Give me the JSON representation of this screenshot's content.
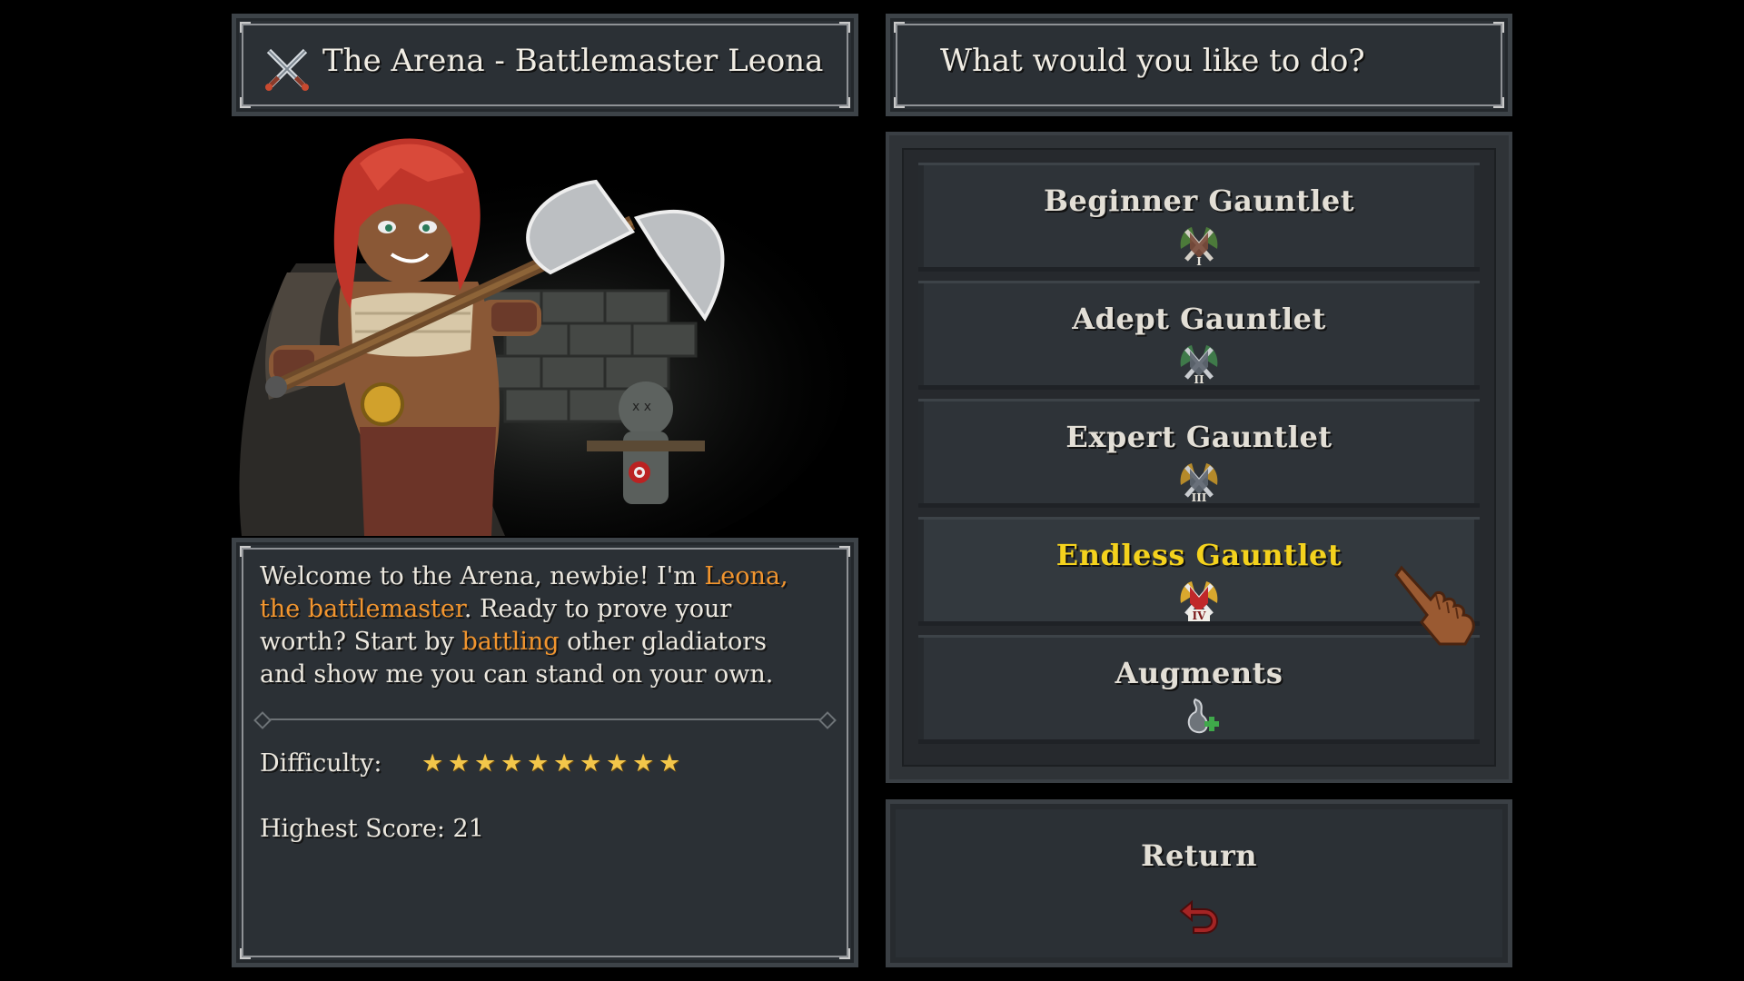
{
  "left_panel": {
    "title": "The Arena - Battlemaster Leona",
    "title_icon": "crossed-swords-icon"
  },
  "dialog": {
    "part1": "Welcome to the Arena, newbie! I'm ",
    "highlight1": "Leona, the battlemaster",
    "part2": ". Ready to prove your worth? Start by ",
    "highlight2": "battling",
    "part3": " other gladiators and show me you can stand on your own.",
    "highlight_color": "#f2952e"
  },
  "stats": {
    "difficulty_label": "Difficulty:",
    "difficulty_stars": 10,
    "highest_score_text": "Highest Score: 21"
  },
  "right_panel": {
    "prompt": "What would you like to do?"
  },
  "menu": {
    "items": [
      {
        "label": "Beginner Gauntlet",
        "icon": "gauntlet-rank-1-icon",
        "rank": "I",
        "active": false
      },
      {
        "label": "Adept Gauntlet",
        "icon": "gauntlet-rank-2-icon",
        "rank": "II",
        "active": false
      },
      {
        "label": "Expert Gauntlet",
        "icon": "gauntlet-rank-3-icon",
        "rank": "III",
        "active": false
      },
      {
        "label": "Endless Gauntlet",
        "icon": "gauntlet-rank-4-icon",
        "rank": "IV",
        "active": true
      },
      {
        "label": "Augments",
        "icon": "augment-flask-plus-icon",
        "active": false
      }
    ],
    "active_color": "#f4d21d"
  },
  "return_button": {
    "label": "Return",
    "icon": "return-arrow-icon"
  }
}
